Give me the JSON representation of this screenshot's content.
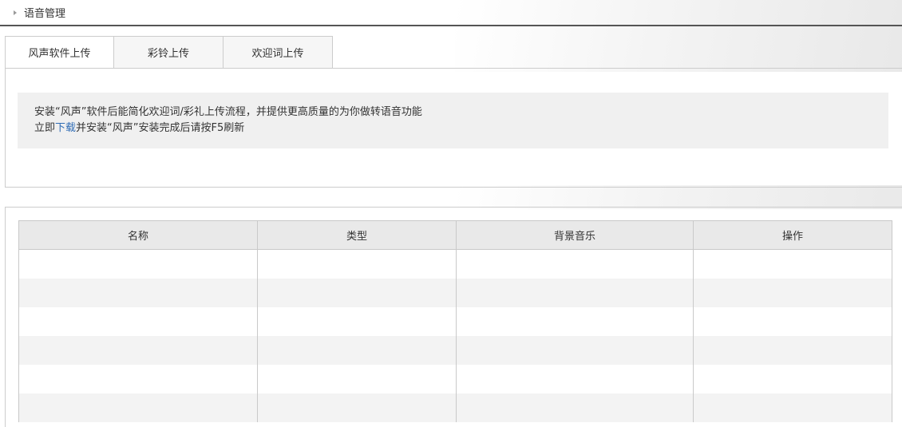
{
  "breadcrumb": {
    "title": "语音管理"
  },
  "tabs": [
    {
      "label": "风声软件上传",
      "active": true
    },
    {
      "label": "彩铃上传",
      "active": false
    },
    {
      "label": "欢迎词上传",
      "active": false
    }
  ],
  "notice": {
    "line1": "安装“风声”软件后能简化欢迎词/彩礼上传流程，并提供更高质量的为你做转语音功能",
    "line2_prefix": "立即",
    "download_link": "下载",
    "line2_suffix": "并安装“风声”安装完成后请按F5刷新"
  },
  "table": {
    "columns": [
      "名称",
      "类型",
      "背景音乐",
      "操作"
    ],
    "rows": [
      [
        "",
        "",
        "",
        ""
      ],
      [
        "",
        "",
        "",
        ""
      ],
      [
        "",
        "",
        "",
        ""
      ],
      [
        "",
        "",
        "",
        ""
      ],
      [
        "",
        "",
        "",
        ""
      ],
      [
        "",
        "",
        "",
        ""
      ]
    ]
  },
  "colors": {
    "link": "#2f6cb5",
    "header_bg": "#e9e9e9",
    "stripe": "#f3f3f3",
    "notice_bg": "#f0f0f0"
  }
}
